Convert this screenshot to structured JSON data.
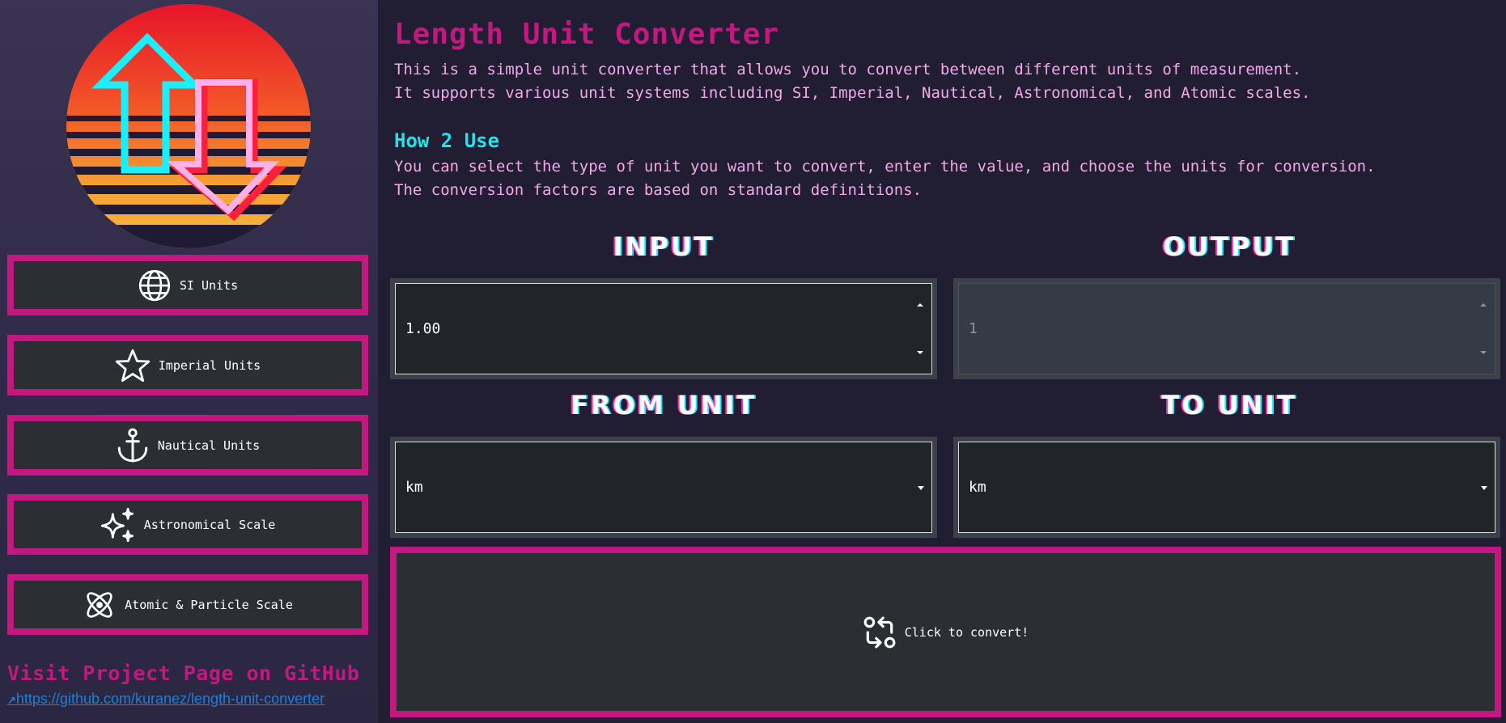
{
  "sidebar": {
    "items": [
      {
        "label": "SI Units",
        "icon": "globe-icon"
      },
      {
        "label": "Imperial Units",
        "icon": "star-icon"
      },
      {
        "label": "Nautical Units",
        "icon": "anchor-icon"
      },
      {
        "label": "Astronomical Scale",
        "icon": "sparkles-icon"
      },
      {
        "label": "Atomic & Particle Scale",
        "icon": "atom-icon"
      }
    ],
    "github_title": "Visit Project Page on GitHub",
    "github_link": "https://github.com/kuranez/length-unit-converter",
    "github_link_icon": "arrow-up-right-icon"
  },
  "main": {
    "title": "Length Unit Converter",
    "intro": [
      "This is a simple unit converter that allows you to convert between different units of measurement.",
      "It supports various unit systems including SI, Imperial, Nautical, Astronomical, and Atomic scales."
    ],
    "howto_title": "How 2 Use",
    "howto": [
      "You can select the type of unit you want to convert, enter the value, and choose the units for conversion.",
      "The conversion factors are based on standard definitions."
    ],
    "input_heading": "INPUT",
    "output_heading": "OUTPUT",
    "from_heading": "FROM UNIT",
    "to_heading": "TO UNIT",
    "input_value": "1.00",
    "output_value": "1",
    "from_unit": "km",
    "to_unit": "km",
    "convert_label": "Click to convert!",
    "convert_icon": "swap-icon"
  },
  "colors": {
    "accent_pink": "#c2187f",
    "cyan": "#1fe6ee",
    "text_pink": "#f1a9e8",
    "background": "#211d33",
    "button_bg": "#2b2e33"
  }
}
